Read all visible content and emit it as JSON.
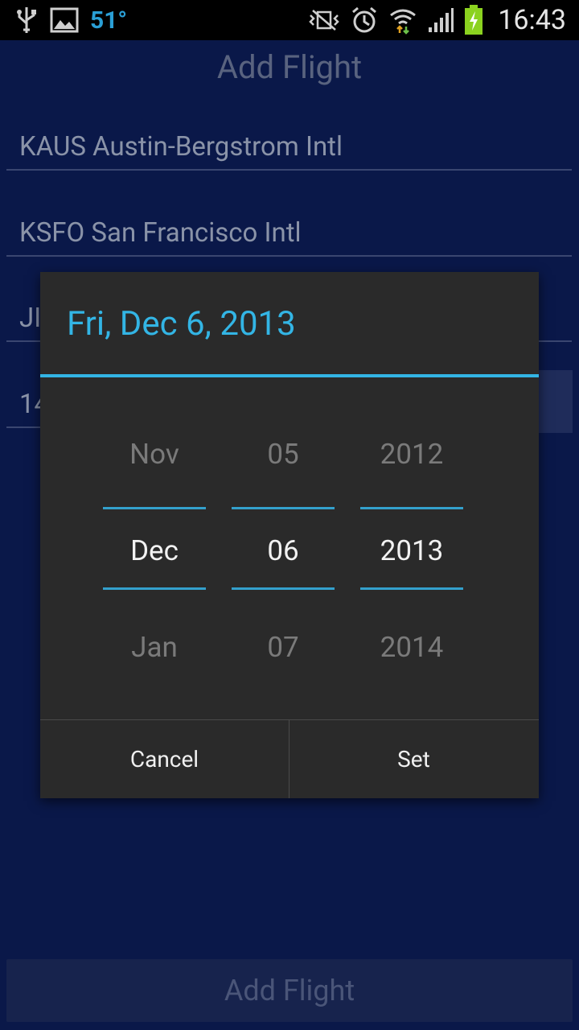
{
  "status_bar": {
    "temperature": "51°",
    "time": "16:43",
    "icons": [
      "usb-icon",
      "image-icon",
      "vibrate-off-icon",
      "alarm-icon",
      "wifi-icon",
      "signal-icon",
      "battery-charging-icon"
    ],
    "colors": {
      "temperature": "#2a9fd6",
      "battery": "#8bd21f"
    }
  },
  "app": {
    "title": "Add Flight",
    "fields": [
      {
        "value": "KAUS Austin-Bergstrom Intl"
      },
      {
        "value": "KSFO San Francisco Intl"
      },
      {
        "value": "JI"
      },
      {
        "value": "14"
      }
    ],
    "submit_label": "Add Flight",
    "colors": {
      "background": "#0a1849"
    }
  },
  "date_dialog": {
    "title": "Fri, Dec 6, 2013",
    "month": {
      "prev": "Nov",
      "current": "Dec",
      "next": "Jan"
    },
    "day": {
      "prev": "05",
      "current": "06",
      "next": "07"
    },
    "year": {
      "prev": "2012",
      "current": "2013",
      "next": "2014"
    },
    "cancel_label": "Cancel",
    "set_label": "Set",
    "colors": {
      "accent": "#33b5e5",
      "background": "#2a2a2a"
    }
  }
}
